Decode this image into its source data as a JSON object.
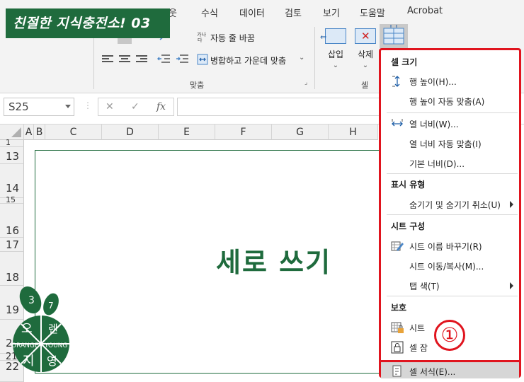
{
  "banner": {
    "title": "친절한 지식충전소! 03"
  },
  "ribbon": {
    "tabs": [
      "웃",
      "수식",
      "데이터",
      "검토",
      "보기",
      "도움말",
      "Acrobat"
    ],
    "wrap_text": "자동 줄 바꿈",
    "merge_center": "병합하고 가운데 맞춤",
    "alignment_group": "맞춤",
    "cells_group": "셀",
    "insert": "삽입",
    "delete": "삭제"
  },
  "formula_bar": {
    "name_box": "S25",
    "fx": "fx",
    "cancel": "✕",
    "enter": "✓",
    "formula": ""
  },
  "grid": {
    "columns": [
      "A",
      "B",
      "C",
      "D",
      "E",
      "F",
      "G",
      "H"
    ],
    "rows": [
      "1",
      "13",
      "14",
      "15",
      "16",
      "17",
      "18",
      "19",
      "20",
      "21",
      "22"
    ],
    "cell_text": "세로 쓰기"
  },
  "logo": {
    "lines": [
      "3",
      "7",
      "오",
      "렌",
      "ORANGE",
      "YOUNG",
      "지",
      "영"
    ]
  },
  "menu": {
    "section_cell_size": "셀 크기",
    "row_height": "행 높이(H)...",
    "autofit_row": "행 높이 자동 맞춤(A)",
    "column_width": "열 너비(W)...",
    "autofit_column": "열 너비 자동 맞춤(I)",
    "default_width": "기본 너비(D)...",
    "section_visibility": "표시 유형",
    "hide_unhide": "숨기기 및 숨기기 취소(U)",
    "section_organize": "시트 구성",
    "rename_sheet": "시트 이름 바꾸기(R)",
    "move_copy": "시트 이동/복사(M)...",
    "tab_color": "탭 색(T)",
    "section_protection": "보호",
    "protect_sheet": "시트",
    "lock_cell": "셀 잠",
    "format_cells": "셀 서식(E)..."
  },
  "annotation": {
    "step": "①"
  },
  "colors": {
    "accent_green": "#1f6b3d",
    "highlight_red": "#e0141e"
  }
}
